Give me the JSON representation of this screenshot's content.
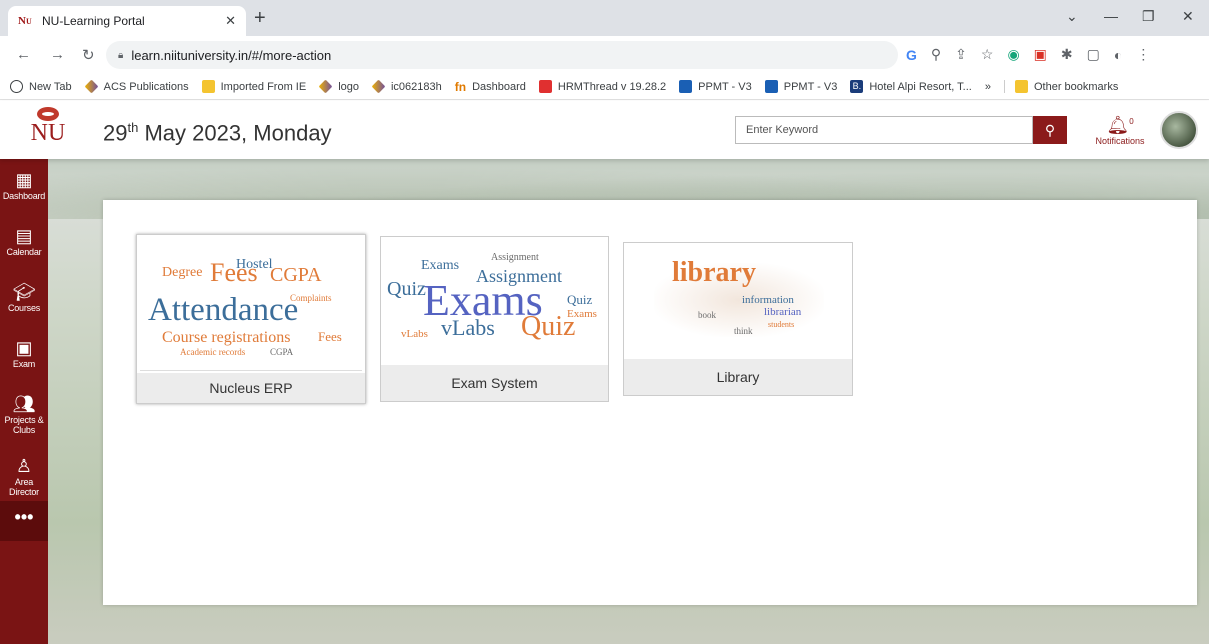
{
  "browser": {
    "tab_title": "NU-Learning Portal",
    "url": "learn.niituniversity.in/#/more-action",
    "bookmarks": [
      {
        "label": "New Tab",
        "icon": "globe-icon"
      },
      {
        "label": "ACS Publications",
        "icon": "diamond-icon"
      },
      {
        "label": "Imported From IE",
        "icon": "folder-icon"
      },
      {
        "label": "logo",
        "icon": "diamond-icon"
      },
      {
        "label": "ic062183h",
        "icon": "diamond-icon"
      },
      {
        "label": "Dashboard",
        "icon": "fn-icon"
      },
      {
        "label": "HRMThread v 19.28.2",
        "icon": "hrm-icon"
      },
      {
        "label": "PPMT - V3",
        "icon": "eu-icon"
      },
      {
        "label": "PPMT - V3",
        "icon": "eu-icon"
      },
      {
        "label": "Hotel Alpi Resort, T...",
        "icon": "booking-icon"
      }
    ],
    "other_bookmarks": "Other bookmarks",
    "overflow": "»"
  },
  "header": {
    "logo_text": "NU",
    "date_day": "29",
    "date_suffix": "th",
    "date_rest": " May 2023, Monday",
    "search_placeholder": "Enter Keyword",
    "notifications_label": "Notifications",
    "notification_count": "0"
  },
  "sidebar": {
    "items": [
      {
        "label": "Dashboard"
      },
      {
        "label": "Calendar"
      },
      {
        "label": "Courses"
      },
      {
        "label": "Exam"
      },
      {
        "label": "Projects &"
      },
      {
        "label": "Clubs"
      },
      {
        "label": "Area Director"
      }
    ],
    "more": "•••"
  },
  "cards": [
    {
      "label": "Nucleus ERP"
    },
    {
      "label": "Exam System"
    },
    {
      "label": "Library"
    }
  ],
  "wordcloud_erp": {
    "w1": "Attendance",
    "w2": "Fees",
    "w3": "CGPA",
    "w4": "Hostel",
    "w5": "Degree",
    "w6": "Course registrations",
    "w7": "Fees",
    "w8": "Complaints",
    "w9": "Academic records",
    "w10": "CGPA"
  },
  "wordcloud_exam": {
    "w1": "Exams",
    "w2": "Quiz",
    "w3": "vLabs",
    "w4": "Assignment",
    "w5": "Exams",
    "w6": "Quiz",
    "w7": "vLabs",
    "w8": "Quiz",
    "w9": "Exams",
    "w10": "Assignment"
  },
  "wordcloud_library": {
    "w1": "library",
    "w2": "information",
    "w3": "librarian",
    "w4": "book",
    "w5": "think",
    "w6": "students"
  }
}
